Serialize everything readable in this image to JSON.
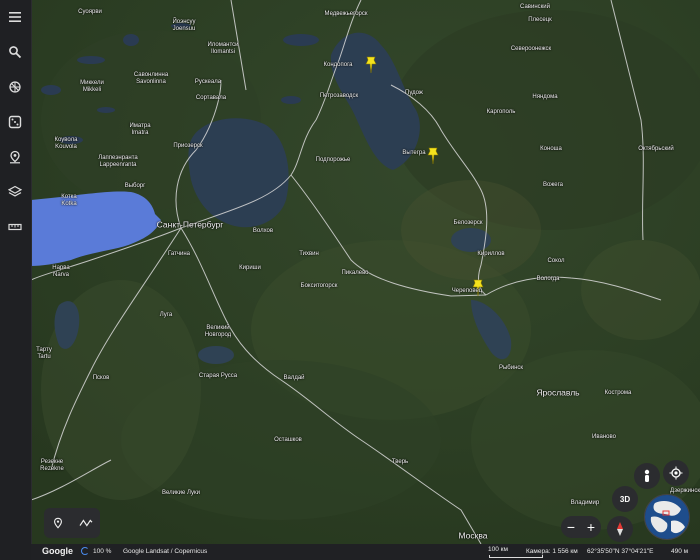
{
  "sidebar": {
    "items": [
      {
        "name": "menu-icon",
        "tooltip": ""
      },
      {
        "name": "search-icon",
        "tooltip": ""
      },
      {
        "name": "voyager-icon",
        "tooltip": ""
      },
      {
        "name": "feeling-lucky-icon",
        "tooltip": ""
      },
      {
        "name": "projects-icon",
        "tooltip": ""
      },
      {
        "name": "map-style-icon",
        "tooltip": ""
      },
      {
        "name": "measure-icon",
        "tooltip": ""
      }
    ]
  },
  "map": {
    "labels": [
      {
        "text": "Медвежьегорск",
        "size": "small"
      },
      {
        "text": "Савинский",
        "size": "small"
      },
      {
        "text": "Плесецк",
        "size": "small"
      },
      {
        "text": "Кондопога",
        "size": "small"
      },
      {
        "text": "Североонежск",
        "size": "small"
      },
      {
        "text": "Суоярви",
        "size": "small"
      },
      {
        "text": "Йоэнсуу",
        "size": "small"
      },
      {
        "text": "Joensuu",
        "size": "small"
      },
      {
        "text": "Иломантси",
        "size": "small"
      },
      {
        "text": "Ilomantsi",
        "size": "small"
      },
      {
        "text": "Савонлинна",
        "size": "small"
      },
      {
        "text": "Savonlinna",
        "size": "small"
      },
      {
        "text": "Миккели",
        "size": "small"
      },
      {
        "text": "Mikkeli",
        "size": "small"
      },
      {
        "text": "Рускеала",
        "size": "small"
      },
      {
        "text": "Сортавала",
        "size": "small"
      },
      {
        "text": "Петрозаводск",
        "size": "small"
      },
      {
        "text": "Пудож",
        "size": "small"
      },
      {
        "text": "Няндома",
        "size": "small"
      },
      {
        "text": "Каргополь",
        "size": "small"
      },
      {
        "text": "Иматра",
        "size": "small"
      },
      {
        "text": "Imatra",
        "size": "small"
      },
      {
        "text": "Коувола",
        "size": "small"
      },
      {
        "text": "Kouvola",
        "size": "small"
      },
      {
        "text": "Лаппеэнранта",
        "size": "small"
      },
      {
        "text": "Lappeenranta",
        "size": "small"
      },
      {
        "text": "Приозерск",
        "size": "small"
      },
      {
        "text": "Подпорожье",
        "size": "small"
      },
      {
        "text": "Вытегра",
        "size": "small"
      },
      {
        "text": "Коноша",
        "size": "small"
      },
      {
        "text": "Октябрьский",
        "size": "small"
      },
      {
        "text": "Выборг",
        "size": "small"
      },
      {
        "text": "Котка",
        "size": "small"
      },
      {
        "text": "Kotka",
        "size": "small"
      },
      {
        "text": "Белозерск",
        "size": "small"
      },
      {
        "text": "Вожега",
        "size": "small"
      },
      {
        "text": "Санкт-Петербург",
        "size": "big"
      },
      {
        "text": "Волхов",
        "size": "small"
      },
      {
        "text": "Тихвин",
        "size": "small"
      },
      {
        "text": "Кириллов",
        "size": "small"
      },
      {
        "text": "Сокол",
        "size": "small"
      },
      {
        "text": "Гатчина",
        "size": "small"
      },
      {
        "text": "Нарва",
        "size": "small"
      },
      {
        "text": "Narva",
        "size": "small"
      },
      {
        "text": "Кириши",
        "size": "small"
      },
      {
        "text": "Пикалево",
        "size": "small"
      },
      {
        "text": "Череповец",
        "size": "small"
      },
      {
        "text": "Вологда",
        "size": "small"
      },
      {
        "text": "Бокситогорск",
        "size": "small"
      },
      {
        "text": "Луга",
        "size": "small"
      },
      {
        "text": "Великий",
        "size": "small"
      },
      {
        "text": "Новгород",
        "size": "small"
      },
      {
        "text": "Тарту",
        "size": "small"
      },
      {
        "text": "Tartu",
        "size": "small"
      },
      {
        "text": "Рыбинск",
        "size": "small"
      },
      {
        "text": "Старая Русса",
        "size": "small"
      },
      {
        "text": "Псков",
        "size": "small"
      },
      {
        "text": "Валдай",
        "size": "small"
      },
      {
        "text": "Ярославль",
        "size": "big"
      },
      {
        "text": "Кострома",
        "size": "small"
      },
      {
        "text": "Осташков",
        "size": "small"
      },
      {
        "text": "Иваново",
        "size": "small"
      },
      {
        "text": "Резекне",
        "size": "small"
      },
      {
        "text": "Rezekne",
        "size": "small"
      },
      {
        "text": "Тверь",
        "size": "small"
      },
      {
        "text": "Великие Луки",
        "size": "small"
      },
      {
        "text": "Владимир",
        "size": "small"
      },
      {
        "text": "Дзержинск",
        "size": "small"
      },
      {
        "text": "Москва",
        "size": "big"
      }
    ],
    "pins": [
      {
        "name": "pin-kondopoga"
      },
      {
        "name": "pin-vytegra"
      },
      {
        "name": "pin-cherepovets"
      }
    ]
  },
  "controls": {
    "btn3d": "3D",
    "zoom_out": "−",
    "zoom_in": "+"
  },
  "status": {
    "logo": "Google",
    "progress": "100 %",
    "attribution": "Google  Landsat / Copernicus",
    "scale": "100 км",
    "camera": "Камера: 1 556 км",
    "coords": "62°35'50\"N 37°04'21\"E",
    "elevation": "490 м"
  },
  "colors": {
    "sidebar_bg": "#1f2023",
    "statusbar_bg": "#202124",
    "water": "#3f5e8f",
    "selected_water": "#5a7bd8",
    "pin": "#f5e31d",
    "road": "#d9d9d9"
  }
}
